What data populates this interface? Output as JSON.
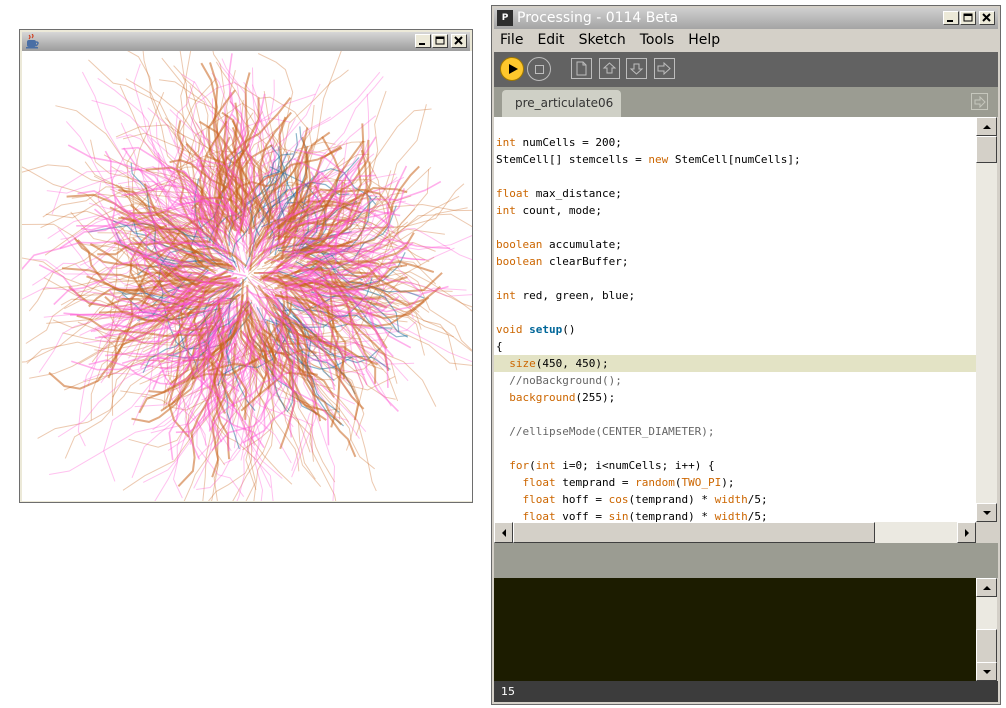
{
  "sketch_window": {
    "title": ""
  },
  "ide": {
    "title": "Processing - 0114 Beta",
    "app_icon": "P",
    "menu": [
      "File",
      "Edit",
      "Sketch",
      "Tools",
      "Help"
    ],
    "toolbar": {
      "buttons": [
        "run-icon",
        "stop-icon",
        "new-icon",
        "open-icon",
        "save-icon",
        "export-icon"
      ]
    },
    "tab_label": "pre_articulate06 §",
    "code_lines": [
      "",
      "int numCells = 200;",
      "StemCell[] stemcells = new StemCell[numCells];",
      "",
      "float max_distance;",
      "int count, mode;",
      "",
      "boolean accumulate;",
      "boolean clearBuffer;",
      "",
      "int red, green, blue;",
      "",
      "void setup()",
      "{",
      "  size(450, 450);",
      "  //noBackground();",
      "  background(255);",
      "",
      "  //ellipseMode(CENTER_DIAMETER);",
      "",
      "  for(int i=0; i<numCells; i++) {",
      "    float temprand = random(TWO_PI);",
      "    float hoff = cos(temprand) * width/5;",
      "    float voff = sin(temprand) * width/5;"
    ],
    "highlighted_line": 14,
    "status_line": "15",
    "colors": {
      "keyword": "#cc6600",
      "function": "#006699",
      "comment": "#666666",
      "run_button": "#fec72c",
      "art_orange": "#c8641e",
      "art_pink": "#ff4ed2",
      "art_blue": "#1c6e9a"
    }
  }
}
